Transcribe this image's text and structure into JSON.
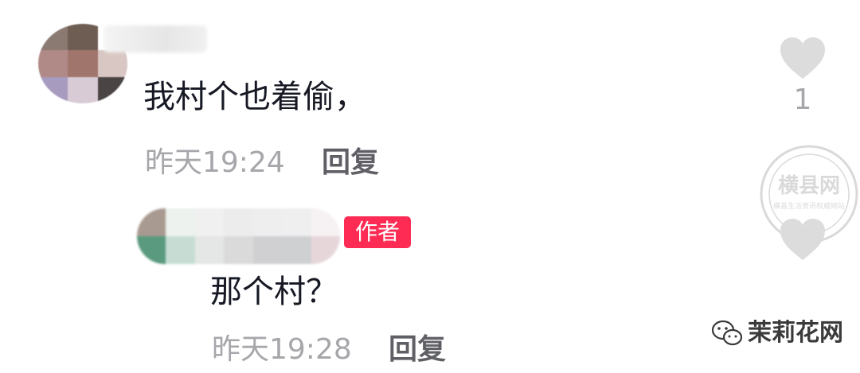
{
  "comments": [
    {
      "text": "我村个也着偷，",
      "time": "昨天19:24",
      "reply_label": "回复",
      "likes": "1"
    },
    {
      "badge": "作者",
      "text": "那个村？",
      "time": "昨天19:28",
      "reply_label": "回复"
    }
  ],
  "watermark": {
    "stamp_title": "横县网",
    "stamp_subtitle": "横县生活资讯权威网站",
    "brand_text": "茉莉花网"
  },
  "icons": {
    "like": "heart-icon",
    "wechat": "wechat-icon"
  },
  "colors": {
    "badge": "#fe2c55",
    "meta_text": "#a6a6ab",
    "reply_text": "#5f5f66",
    "heart": "#dcdcdc"
  }
}
